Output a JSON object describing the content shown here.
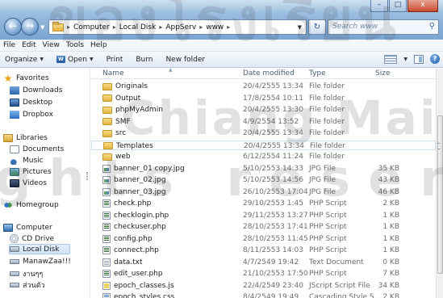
{
  "window": {
    "controls": [
      "–",
      "□",
      "x"
    ]
  },
  "addressbar": {
    "crumbs": [
      "Computer",
      "Local Disk",
      "AppServ",
      "www"
    ],
    "search_placeholder": "Search www"
  },
  "menu": [
    "File",
    "Edit",
    "View",
    "Tools",
    "Help"
  ],
  "toolbar": {
    "organize": "Organize",
    "open": "Open",
    "print": "Print",
    "burn": "Burn",
    "new_folder": "New folder"
  },
  "nav": {
    "favorites": "Favorites",
    "downloads": "Downloads",
    "desktop": "Desktop",
    "dropbox": "Dropbox",
    "libraries": "Libraries",
    "documents": "Documents",
    "music": "Music",
    "pictures": "Pictures",
    "videos": "Videos",
    "homegroup": "Homegroup",
    "computer": "Computer",
    "cd_drive": "CD Drive",
    "local_disk": "Local Disk",
    "manawzaa": "ManawZaa!!!",
    "drive_th1": "งานๆๆ",
    "drive_th2": "ส่วนตัว"
  },
  "columns": {
    "name": "Name",
    "date": "Date modified",
    "type": "Type",
    "size": "Size"
  },
  "files": [
    {
      "name": "Originals",
      "date": "20/4/2555 13:34",
      "type": "File folder",
      "size": "",
      "icon": "folder"
    },
    {
      "name": "Output",
      "date": "17/8/2554 10:11",
      "type": "File folder",
      "size": "",
      "icon": "folder"
    },
    {
      "name": "phpMyAdmin",
      "date": "20/4/2555 13:30",
      "type": "File folder",
      "size": "",
      "icon": "folder"
    },
    {
      "name": "SMF",
      "date": "4/9/2554 13:52",
      "type": "File folder",
      "size": "",
      "icon": "folder"
    },
    {
      "name": "src",
      "date": "20/4/2555 13:34",
      "type": "File folder",
      "size": "",
      "icon": "folder"
    },
    {
      "name": "Templates",
      "date": "20/4/2555 13:34",
      "type": "File folder",
      "size": "",
      "icon": "folder"
    },
    {
      "name": "web",
      "date": "6/12/2554 11:24",
      "type": "File folder",
      "size": "",
      "icon": "folder"
    },
    {
      "name": "banner_01 copy.jpg",
      "date": "5/10/2553 14:33",
      "type": "JPG File",
      "size": "35 KB",
      "icon": "jpg"
    },
    {
      "name": "banner_02.jpg",
      "date": "5/10/2553 14:56",
      "type": "JPG File",
      "size": "43 KB",
      "icon": "jpg"
    },
    {
      "name": "banner_03.jpg",
      "date": "26/10/2553 17:04",
      "type": "JPG File",
      "size": "46 KB",
      "icon": "jpg"
    },
    {
      "name": "check.php",
      "date": "29/10/2553 1:45",
      "type": "PHP Script",
      "size": "2 KB",
      "icon": "php"
    },
    {
      "name": "checklogin.php",
      "date": "29/11/2553 13:27",
      "type": "PHP Script",
      "size": "1 KB",
      "icon": "php"
    },
    {
      "name": "checkuser.php",
      "date": "28/10/2553 17:41",
      "type": "PHP Script",
      "size": "1 KB",
      "icon": "php"
    },
    {
      "name": "config.php",
      "date": "28/10/2553 11:45",
      "type": "PHP Script",
      "size": "1 KB",
      "icon": "php"
    },
    {
      "name": "connect.php",
      "date": "8/11/2553 14:03",
      "type": "PHP Script",
      "size": "1 KB",
      "icon": "php"
    },
    {
      "name": "data.txt",
      "date": "4/7/2549 19:42",
      "type": "Text Document",
      "size": "0 KB",
      "icon": "txt"
    },
    {
      "name": "edit_user.php",
      "date": "21/10/2553 17:50",
      "type": "PHP Script",
      "size": "7 KB",
      "icon": "php"
    },
    {
      "name": "epoch_classes.js",
      "date": "22/4/2549 23:40",
      "type": "JScript Script File",
      "size": "34 KB",
      "icon": "js"
    },
    {
      "name": "epoch_styles.css",
      "date": "8/4/2549 19:49",
      "type": "Cascading Style S...",
      "size": "2 KB",
      "icon": "css"
    }
  ],
  "watermark": {
    "line1": "ของโรงเรียน",
    "line2": "Chiang Mai U",
    "line3": "ghts reserved"
  }
}
